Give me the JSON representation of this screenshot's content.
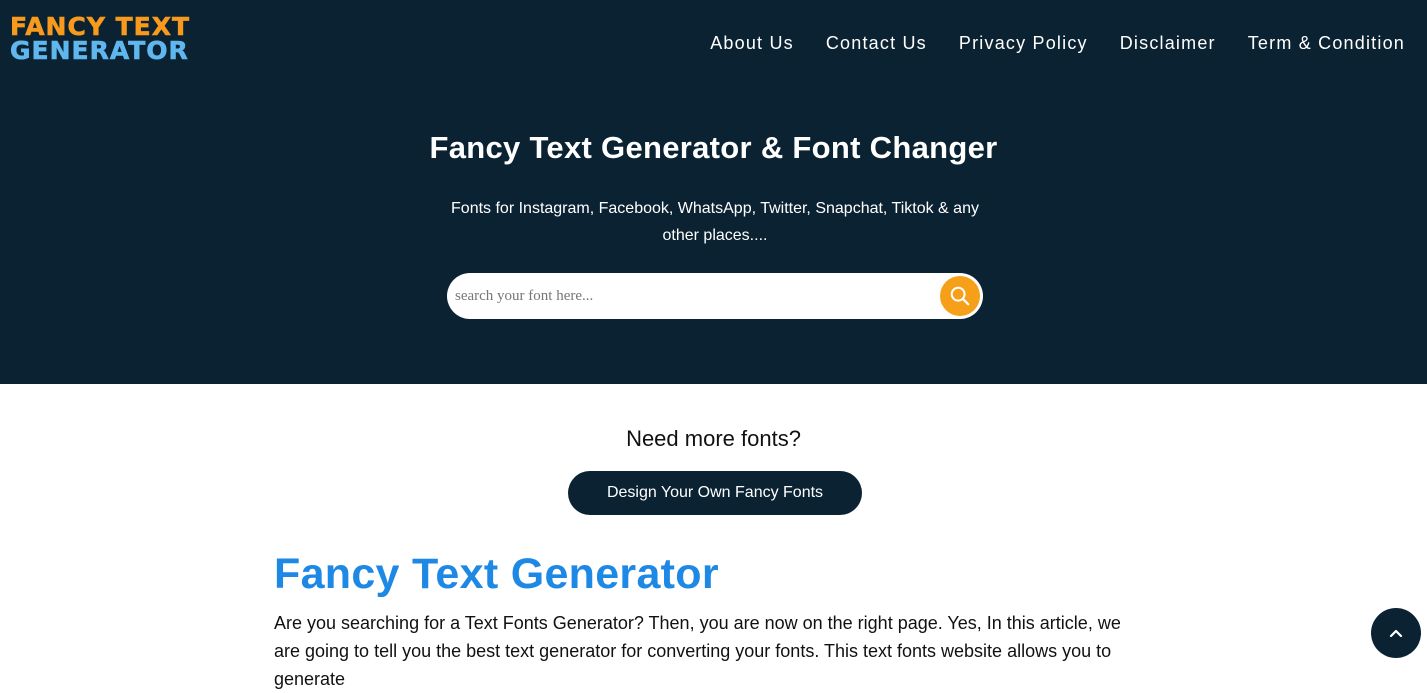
{
  "header": {
    "logo_line1": "FANCY TEXT",
    "logo_line2": "GENERATOR",
    "nav": [
      {
        "label": "About Us"
      },
      {
        "label": "Contact Us"
      },
      {
        "label": "Privacy Policy"
      },
      {
        "label": "Disclaimer"
      },
      {
        "label": "Term & Condition"
      }
    ]
  },
  "hero": {
    "title": "Fancy Text Generator & Font Changer",
    "subtitle": "Fonts for Instagram, Facebook, WhatsApp, Twitter, Snapchat, Tiktok & any other places....",
    "search_placeholder": "search your font here...",
    "search_icon": "search-icon"
  },
  "promo": {
    "question": "Need more fonts?",
    "button_label": "Design Your Own Fancy Fonts"
  },
  "article": {
    "title": "Fancy Text Generator",
    "text": "Are you searching for a Text Fonts Generator? Then, you are now on the right page. Yes, In this article, we are going to tell you the best text generator for converting your fonts. This text fonts website allows you to generate"
  },
  "scroll_top_icon": "chevron-up-icon",
  "colors": {
    "header_bg": "#0b2233",
    "logo_orange": "#f79a1d",
    "logo_blue": "#5fb7ee",
    "accent_orange": "#f6a01a",
    "title_blue": "#1e88e5"
  }
}
